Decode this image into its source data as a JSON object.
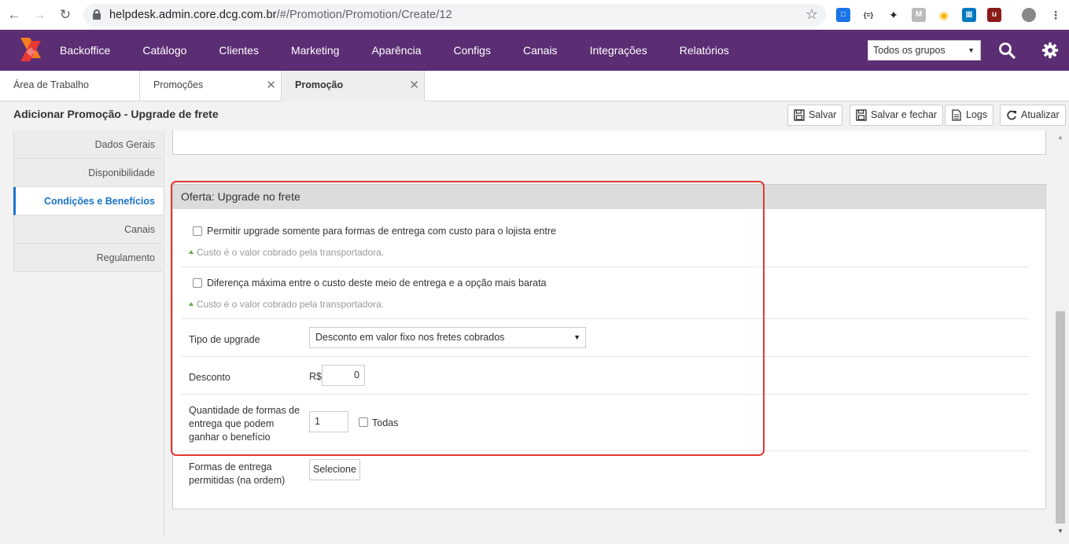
{
  "browser": {
    "url_host": "helpdesk.admin.core.dcg.com.br",
    "url_path": "/#/Promotion/Promotion/Create/12"
  },
  "topnav": {
    "menu": [
      "Backoffice",
      "Catálogo",
      "Clientes",
      "Marketing",
      "Aparência",
      "Configs",
      "Canais",
      "Integrações",
      "Relatórios"
    ],
    "group_select": "Todos os grupos"
  },
  "tabs": [
    {
      "label": "Área de Trabalho"
    },
    {
      "label": "Promoções"
    },
    {
      "label": "Promoção"
    }
  ],
  "header": {
    "title": "Adicionar Promoção - Upgrade de frete",
    "buttons": {
      "save": "Salvar",
      "save_close": "Salvar e fechar",
      "logs": "Logs",
      "refresh": "Atualizar"
    }
  },
  "sidenav": {
    "items": [
      "Dados Gerais",
      "Disponibilidade",
      "Condições e Benefícios",
      "Canais",
      "Regulamento"
    ],
    "active": "Condições e Benefícios"
  },
  "offer": {
    "title": "Oferta: Upgrade no frete",
    "option1_label": "Permitir upgrade somente para formas de entrega com custo para o lojista entre",
    "option1_hint": "Custo é o valor cobrado pela transportadora.",
    "option2_label": "Diferença máxima entre o custo deste meio de entrega e a opção mais barata",
    "option2_hint": "Custo é o valor cobrado pela transportadora.",
    "upgrade_type_label": "Tipo de upgrade",
    "upgrade_type_value": "Desconto em valor fixo nos fretes cobrados",
    "discount_label": "Desconto",
    "currency": "R$",
    "discount_value": "0",
    "quantity_label_1": "Quantidade de formas de",
    "quantity_label_2": "entrega que podem",
    "quantity_label_3": "ganhar o benefício",
    "quantity_value": "1",
    "all_label": "Todas",
    "shipping_label_1": "Formas de entrega",
    "shipping_label_2": "permitidas (na ordem)",
    "select_button": "Selecione"
  },
  "colors": {
    "brand_purple": "#5b2d73",
    "active_blue": "#1a73c8",
    "highlight_red": "#e53935"
  }
}
